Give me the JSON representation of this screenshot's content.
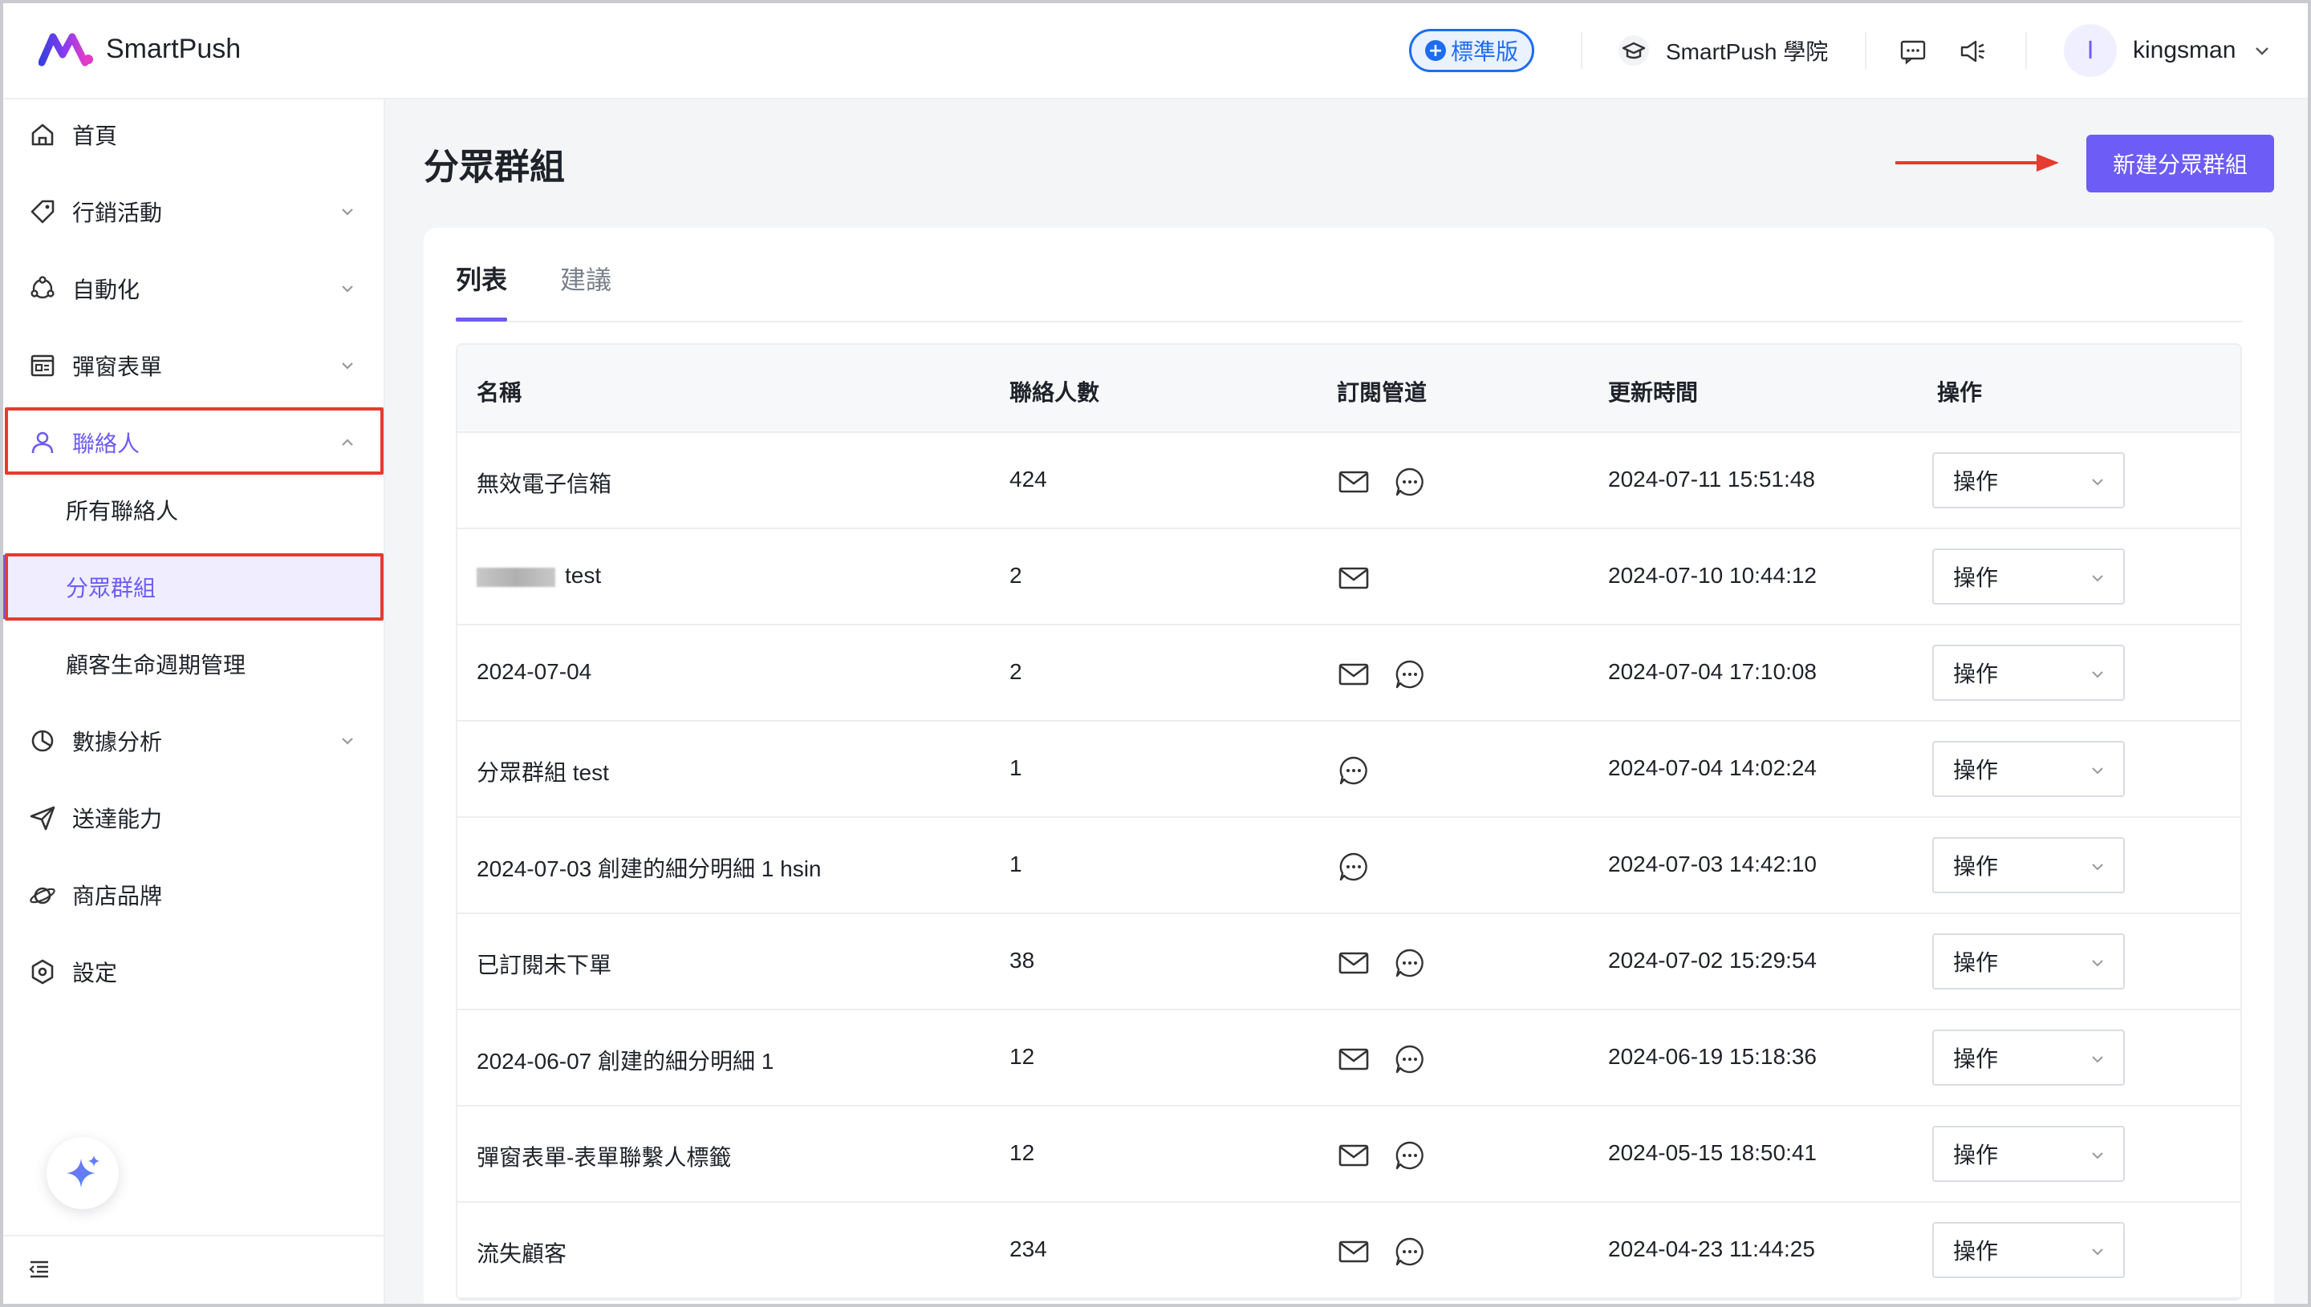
{
  "header": {
    "brand": "SmartPush",
    "plan_badge": "標準版",
    "academy": "SmartPush 學院",
    "user_initial": "I",
    "username": "kingsman"
  },
  "sidebar": {
    "items": [
      {
        "label": "首頁"
      },
      {
        "label": "行銷活動"
      },
      {
        "label": "自動化"
      },
      {
        "label": "彈窗表單"
      },
      {
        "label": "聯絡人"
      },
      {
        "label": "數據分析"
      },
      {
        "label": "送達能力"
      },
      {
        "label": "商店品牌"
      },
      {
        "label": "設定"
      }
    ],
    "contacts_sub": [
      {
        "label": "所有聯絡人"
      },
      {
        "label": "分眾群組"
      },
      {
        "label": "顧客生命週期管理"
      }
    ]
  },
  "main": {
    "title": "分眾群組",
    "create_button": "新建分眾群組",
    "tabs": [
      {
        "label": "列表"
      },
      {
        "label": "建議"
      }
    ],
    "table": {
      "columns": [
        "名稱",
        "聯絡人數",
        "訂閱管道",
        "更新時間",
        "操作"
      ],
      "action_label": "操作",
      "rows": [
        {
          "name": "無效電子信箱",
          "count": "424",
          "email": true,
          "sms": true,
          "updated": "2024-07-11 15:51:48"
        },
        {
          "name": "test",
          "count": "2",
          "email": true,
          "sms": false,
          "updated": "2024-07-10 10:44:12",
          "redacted_prefix": true
        },
        {
          "name": "2024-07-04",
          "count": "2",
          "email": true,
          "sms": true,
          "updated": "2024-07-04 17:10:08"
        },
        {
          "name": "分眾群組 test",
          "count": "1",
          "email": false,
          "sms": true,
          "updated": "2024-07-04 14:02:24"
        },
        {
          "name": "2024-07-03 創建的細分明細 1 hsin",
          "count": "1",
          "email": false,
          "sms": true,
          "updated": "2024-07-03 14:42:10"
        },
        {
          "name": "已訂閱未下單",
          "count": "38",
          "email": true,
          "sms": true,
          "updated": "2024-07-02 15:29:54"
        },
        {
          "name": "2024-06-07 創建的細分明細 1",
          "count": "12",
          "email": true,
          "sms": true,
          "updated": "2024-06-19 15:18:36"
        },
        {
          "name": "彈窗表單-表單聯繫人標籤",
          "count": "12",
          "email": true,
          "sms": true,
          "updated": "2024-05-15 18:50:41"
        },
        {
          "name": "流失顧客",
          "count": "234",
          "email": true,
          "sms": true,
          "updated": "2024-04-23 11:44:25"
        }
      ]
    }
  },
  "colors": {
    "accent": "#6d5cf6",
    "badge_blue": "#1e6cf2",
    "annotation_red": "#e53b30"
  }
}
